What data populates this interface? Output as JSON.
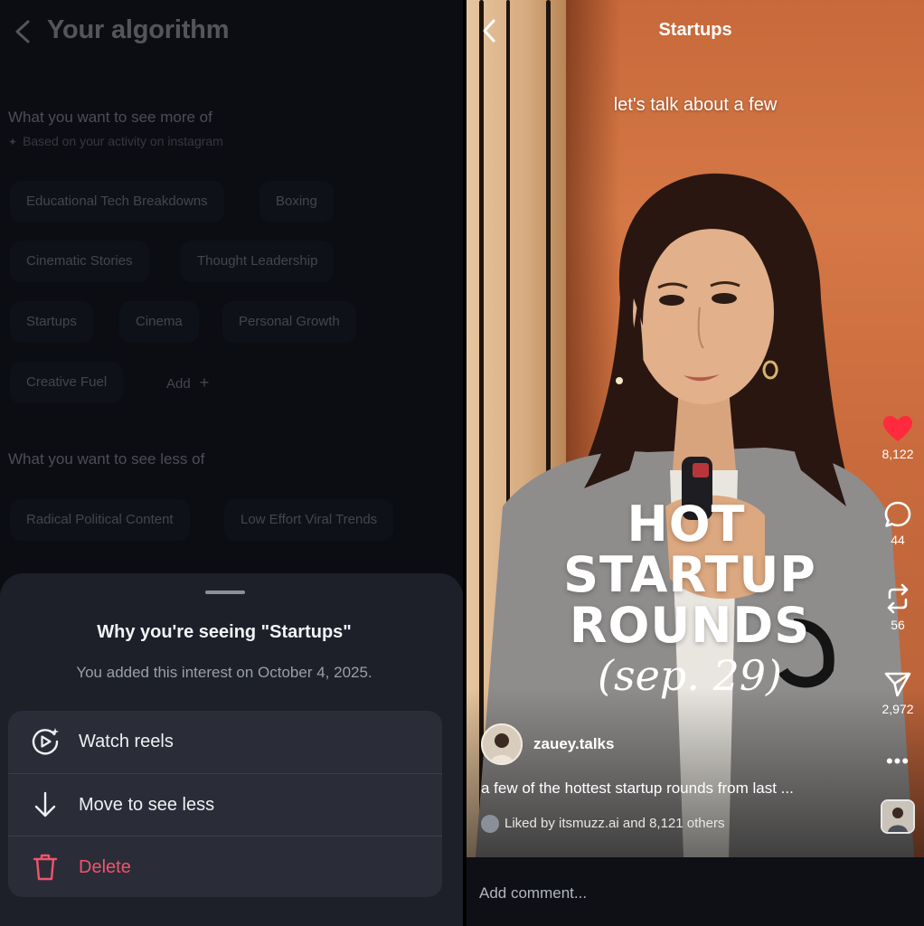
{
  "left": {
    "header": {
      "title": "Your algorithm"
    },
    "more": {
      "title": "What you want to see more of",
      "subtitle": "Based on your activity on instagram",
      "chips": [
        "Educational Tech Breakdowns",
        "Boxing",
        "Cinematic Stories",
        "Thought Leadership",
        "Startups",
        "Cinema",
        "Personal Growth",
        "Creative Fuel"
      ],
      "add_label": "Add"
    },
    "less": {
      "title": "What you want to see less of",
      "chips": [
        "Radical Political Content",
        "Low Effort Viral Trends"
      ]
    },
    "sheet": {
      "title": "Why you're seeing \"Startups\"",
      "subtitle": "You added this interest on October 4, 2025.",
      "items": [
        {
          "label": "Watch reels",
          "icon": "play-circle-icon"
        },
        {
          "label": "Move to see less",
          "icon": "arrow-down-icon"
        },
        {
          "label": "Delete",
          "icon": "trash-icon"
        }
      ]
    }
  },
  "right": {
    "header": {
      "title": "Startups"
    },
    "caption_top": "let's talk about a few",
    "overlay": {
      "line1": "HOT",
      "line2": "STARTUP",
      "line3": "ROUNDS",
      "line4": "(sep. 29)"
    },
    "counts": {
      "likes": "8,122",
      "comments": "44",
      "reposts": "56",
      "shares": "2,972"
    },
    "author": "zauey.talks",
    "description": "a few of the hottest startup rounds from last ...",
    "liked_by": "Liked by itsmuzz.ai and 8,121 others",
    "comment_placeholder": "Add comment...",
    "colors": {
      "like": "#ff2a3d",
      "delete": "#f0546c"
    }
  }
}
